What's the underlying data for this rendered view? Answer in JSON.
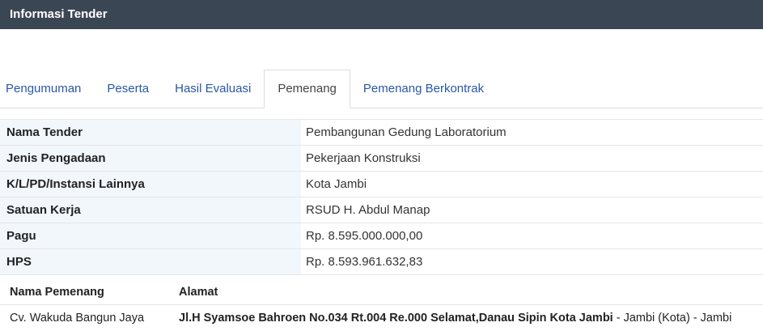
{
  "header": {
    "title": "Informasi Tender"
  },
  "tabs": [
    {
      "label": "Pengumuman",
      "active": false
    },
    {
      "label": "Peserta",
      "active": false
    },
    {
      "label": "Hasil Evaluasi",
      "active": false
    },
    {
      "label": "Pemenang",
      "active": true
    },
    {
      "label": "Pemenang Berkontrak",
      "active": false
    }
  ],
  "info": [
    {
      "label": "Nama Tender",
      "value": "Pembangunan Gedung Laboratorium"
    },
    {
      "label": "Jenis Pengadaan",
      "value": "Pekerjaan Konstruksi"
    },
    {
      "label": "K/L/PD/Instansi Lainnya",
      "value": "Kota Jambi"
    },
    {
      "label": "Satuan Kerja",
      "value": "RSUD H. Abdul Manap"
    },
    {
      "label": "Pagu",
      "value": "Rp. 8.595.000.000,00"
    },
    {
      "label": "HPS",
      "value": "Rp. 8.593.961.632,83"
    }
  ],
  "winner": {
    "headers": {
      "name": "Nama Pemenang",
      "address": "Alamat"
    },
    "name": "Cv. Wakuda Bangun Jaya",
    "address_bold": "Jl.H Syamsoe Bahroen No.034 Rt.004 Re.000 Selamat,Danau Sipin Kota Jambi",
    "address_rest": " - Jambi (Kota) - Jambi"
  }
}
